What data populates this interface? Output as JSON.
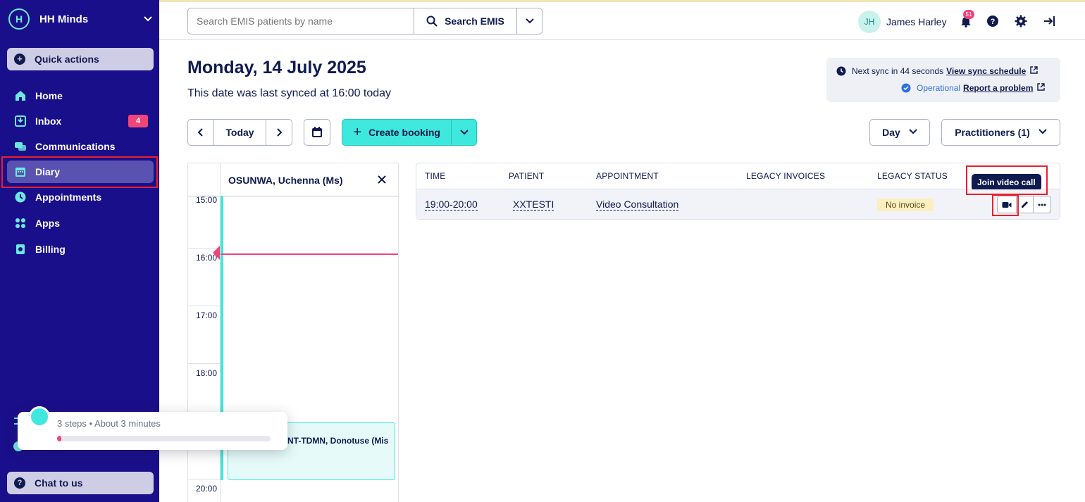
{
  "sidebar": {
    "org_name": "HH Minds",
    "logo_letter": "H",
    "quick_actions": "Quick actions",
    "items": [
      {
        "label": "Home",
        "icon": "home-icon"
      },
      {
        "label": "Inbox",
        "icon": "inbox-icon",
        "badge": "4"
      },
      {
        "label": "Communications",
        "icon": "chat-bubbles-icon"
      },
      {
        "label": "Diary",
        "icon": "calendar-icon",
        "active": true
      },
      {
        "label": "Appointments",
        "icon": "clock-icon"
      },
      {
        "label": "Apps",
        "icon": "apps-grid-icon"
      },
      {
        "label": "Billing",
        "icon": "receipt-icon"
      }
    ],
    "chat": "Chat to us"
  },
  "topbar": {
    "search_placeholder": "Search EMIS patients by name",
    "search_button": "Search EMIS",
    "user_initials": "JH",
    "user_name": "James Harley",
    "notification_count": "51"
  },
  "header": {
    "title": "Monday, 14 July 2025",
    "subtitle": "This date was last synced at 16:00 today",
    "sync_next": "Next sync in 44 seconds",
    "sync_link": "View sync schedule",
    "status": "Operational",
    "report_link": "Report a problem"
  },
  "toolbar": {
    "today": "Today",
    "create_booking": "Create booking",
    "view_mode": "Day",
    "practitioners": "Practitioners (1)"
  },
  "diary": {
    "practitioner": "OSUNWA, Uchenna (Ms)",
    "times": [
      "15:00",
      "16:00",
      "17:00",
      "18:00",
      "20:00"
    ],
    "appointment_text": "NT-TDMN, Donotuse (Mis"
  },
  "tour": {
    "text": "3 steps • About 3 minutes",
    "progress": 0.02
  },
  "table": {
    "headers": [
      "TIME",
      "PATIENT",
      "APPOINTMENT",
      "LEGACY INVOICES",
      "LEGACY STATUS"
    ],
    "rows": [
      {
        "time": "19:00-20:00",
        "patient": "XXTESTI",
        "appointment": "Video Consultation",
        "legacy_invoices": "",
        "status": "No invoice"
      }
    ],
    "tooltip": "Join video call"
  },
  "colors": {
    "sidebar_bg": "#1a0f8a",
    "accent_teal": "#3ee8dc",
    "alert_pink": "#f0457a",
    "highlight_red": "#e8202a"
  }
}
